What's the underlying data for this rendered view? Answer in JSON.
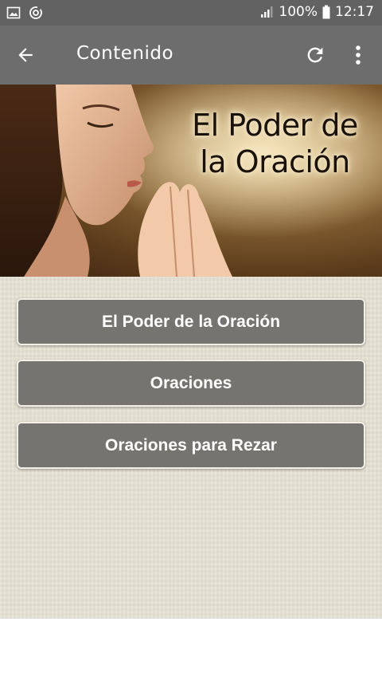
{
  "status_bar": {
    "battery": "100%",
    "time": "12:17",
    "icons": [
      "image-icon",
      "sync-icon",
      "signal-icon",
      "battery-icon"
    ]
  },
  "app_bar": {
    "title": "Contenido",
    "icons": [
      "back-arrow-icon",
      "refresh-icon",
      "more-vert-icon"
    ]
  },
  "banner": {
    "title_line1": "El Poder de",
    "title_line2": "la Oración"
  },
  "menu": {
    "items": [
      {
        "label": "El Poder de la Oración"
      },
      {
        "label": "Oraciones"
      },
      {
        "label": "Oraciones para Rezar"
      }
    ]
  },
  "colors": {
    "status_bar": "#626262",
    "app_bar": "#6d6d6d",
    "button": "#767470",
    "background": "#e5e1d3"
  }
}
